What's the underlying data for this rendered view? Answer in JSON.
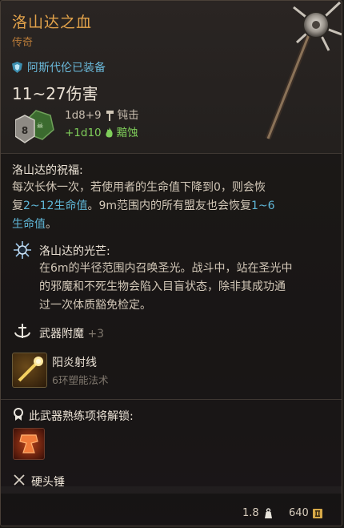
{
  "item": {
    "title": "洛山达之血",
    "rarity": "传奇",
    "equipped_label": "阿斯代伦已装备",
    "damage": "11~27伤害"
  },
  "damage_lines": {
    "die_value": "8",
    "main": "1d8+9",
    "main_type": "钝击",
    "extra": "+1d10",
    "extra_type": "黯蚀"
  },
  "blessing": {
    "title": "洛山达的祝福:",
    "text_1": "每次长休一次，若使用者的生命值下降到0，则会恢",
    "text_2a": "复",
    "text_2b": "2~12生命值",
    "text_2c": "。9m范围内的所有盟友也会恢复",
    "text_2d": "1~6",
    "text_3a": "生命值",
    "text_3b": "。"
  },
  "radiance": {
    "title": "洛山达的光芒:",
    "text_1": "在6m的半径范围内召唤圣光。战斗中，站在圣光中",
    "text_2": "的邪魔和不死生物会陷入目盲状态，除非其成功通",
    "text_3": "过一次体质豁免检定。"
  },
  "enchantment": {
    "label": "武器附魔",
    "value": "+3"
  },
  "spell": {
    "name": "阳炎射线",
    "level": "6环塑能法术"
  },
  "proficiency": {
    "label": "此武器熟练项将解锁:",
    "weapon_type": "硬头锤"
  },
  "footer": {
    "weight": "1.8",
    "price": "640"
  },
  "colors": {
    "title": "#e2a24a",
    "rarity": "#b77a39",
    "highlight": "#5fb6d6",
    "extra_damage": "#7fce5a"
  }
}
